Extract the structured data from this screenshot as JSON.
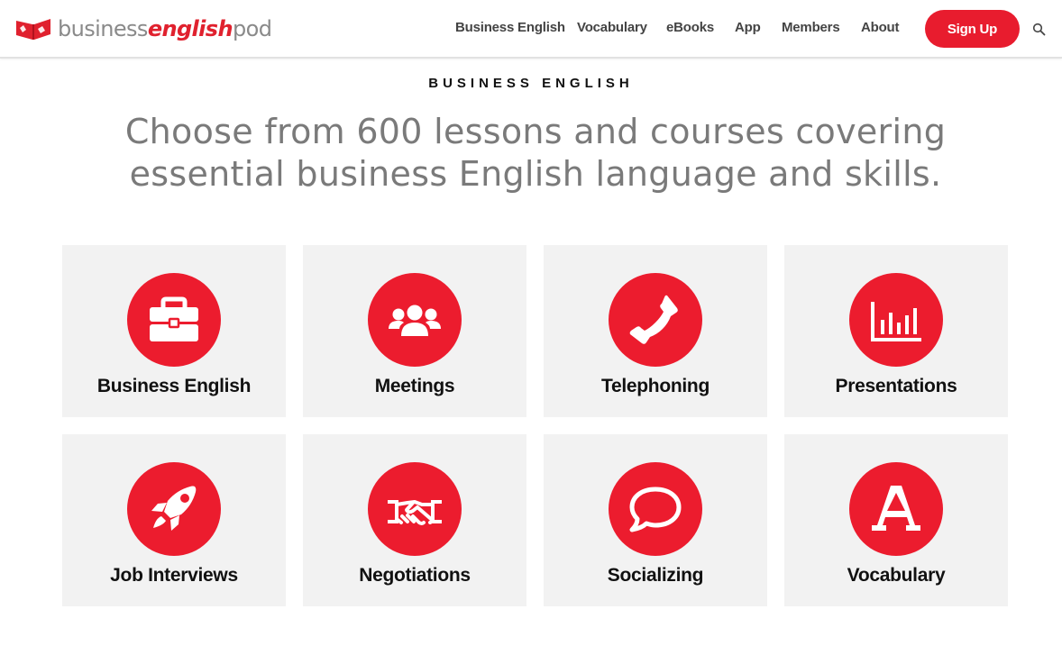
{
  "header": {
    "logo": {
      "part1": "business",
      "part2": "english",
      "part3": "pod",
      "icon": "book-icon"
    },
    "nav": [
      "Business English",
      "Vocabulary",
      "eBooks",
      "App",
      "Members",
      "About"
    ],
    "signup_label": "Sign Up",
    "search_icon": "search-icon"
  },
  "main": {
    "eyebrow": "BUSINESS ENGLISH",
    "headline_line1": "Choose from 600 lessons and courses covering",
    "headline_line2": "essential business English language and skills."
  },
  "cards": [
    {
      "label": "Business English",
      "icon": "briefcase-icon"
    },
    {
      "label": "Meetings",
      "icon": "users-icon"
    },
    {
      "label": "Telephoning",
      "icon": "phone-icon"
    },
    {
      "label": "Presentations",
      "icon": "bar-chart-icon"
    },
    {
      "label": "Job Interviews",
      "icon": "rocket-icon"
    },
    {
      "label": "Negotiations",
      "icon": "handshake-icon"
    },
    {
      "label": "Socializing",
      "icon": "speech-bubble-icon"
    },
    {
      "label": "Vocabulary",
      "icon": "letter-a-icon"
    }
  ],
  "colors": {
    "accent": "#e81c2e",
    "card_bg": "#f2f2f2",
    "headline": "#7a7a7a"
  }
}
